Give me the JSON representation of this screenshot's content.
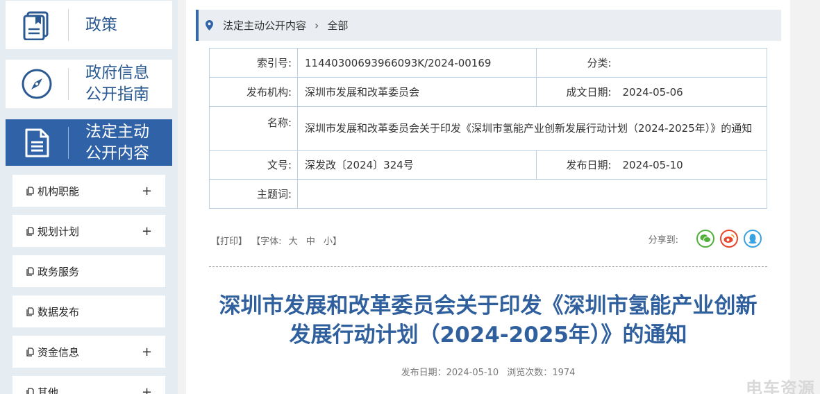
{
  "sidebar": {
    "cards": [
      {
        "label": "政策",
        "icon": "policy-document-icon"
      },
      {
        "label": "政府信息公开指南",
        "line1": "政府信息",
        "line2": "公开指南",
        "icon": "compass-icon"
      },
      {
        "label": "法定主动公开内容",
        "line1": "法定主动",
        "line2": "公开内容",
        "icon": "document-lines-icon"
      }
    ],
    "menu": [
      {
        "label": "机构职能",
        "expand": "+"
      },
      {
        "label": "规划计划",
        "expand": "+"
      },
      {
        "label": "政务服务",
        "expand": ""
      },
      {
        "label": "数据发布",
        "expand": ""
      },
      {
        "label": "资金信息",
        "expand": "+"
      },
      {
        "label": "其他",
        "expand": "+"
      }
    ]
  },
  "breadcrumb": {
    "section": "法定主动公开内容",
    "current": "全部"
  },
  "meta": {
    "index_label": "索引号:",
    "index_value": "11440300693966093K/2024-00169",
    "category_label": "分类:",
    "category_value": "",
    "issuer_label": "发布机构:",
    "issuer_value": "深圳市发展和改革委员会",
    "written_date_label": "成文日期:",
    "written_date_value": "2024-05-06",
    "name_label": "名称:",
    "name_value": "深圳市发展和改革委员会关于印发《深圳市氢能产业创新发展行动计划（2024-2025年）》的通知",
    "docno_label": "文号:",
    "docno_value": "深发改〔2024〕324号",
    "pub_date_label": "发布日期:",
    "pub_date_value": "2024-05-10",
    "subject_label": "主题词:",
    "subject_value": ""
  },
  "tools": {
    "print": "【打印】",
    "font_prefix": "【字体:",
    "font_large": "大",
    "font_medium": "中",
    "font_small": "小】",
    "share_label": "分享到:"
  },
  "article": {
    "title_line1": "深圳市发展和改革委员会关于印发《深圳市氢能产业创新",
    "title_line2": "发展行动计划（2024-2025年）》的通知",
    "pub_label": "发布日期：",
    "pub_date": "2024-05-10",
    "views_label": "浏览次数：",
    "views": "1974"
  },
  "watermark": "电车资源",
  "colors": {
    "brand_blue": "#2f62a6",
    "title_blue": "#2f5f9d",
    "wechat": "#52b13a",
    "weibo": "#e6462c",
    "qq": "#3aa2e0"
  }
}
